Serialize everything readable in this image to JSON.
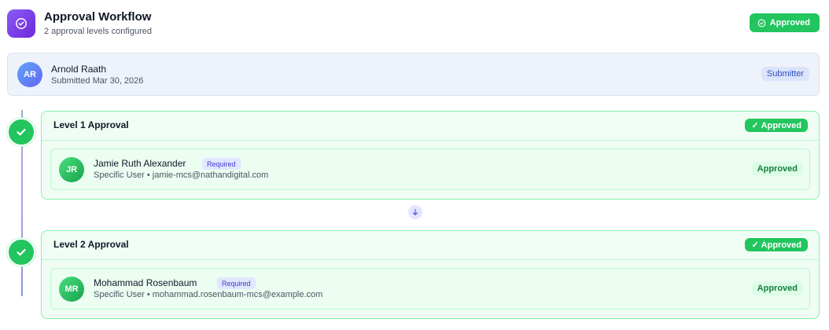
{
  "header": {
    "title": "Approval Workflow",
    "subtitle": "2 approval levels configured",
    "status": "Approved",
    "icon": "check-circle-icon",
    "accent": "#7c3aed"
  },
  "submitter": {
    "initials": "AR",
    "name": "Arnold Raath",
    "date": "Submitted Mar 30, 2026",
    "role": "Submitter"
  },
  "levels": [
    {
      "title": "Level 1 Approval",
      "status": "Approved",
      "approver": {
        "initials": "JR",
        "name": "Jamie Ruth Alexander",
        "required": "Required",
        "meta": "Specific User • jamie-mcs@nathandigital.com",
        "status": "Approved"
      }
    },
    {
      "title": "Level 2 Approval",
      "status": "Approved",
      "approver": {
        "initials": "MR",
        "name": "Mohammad Rosenbaum",
        "required": "Required",
        "meta": "Specific User • mohammad.rosenbaum-mcs@example.com",
        "status": "Approved"
      }
    }
  ],
  "colors": {
    "success": "#22c55e",
    "submitter_bg": "#eef2fb",
    "required_text": "#4338ca"
  }
}
